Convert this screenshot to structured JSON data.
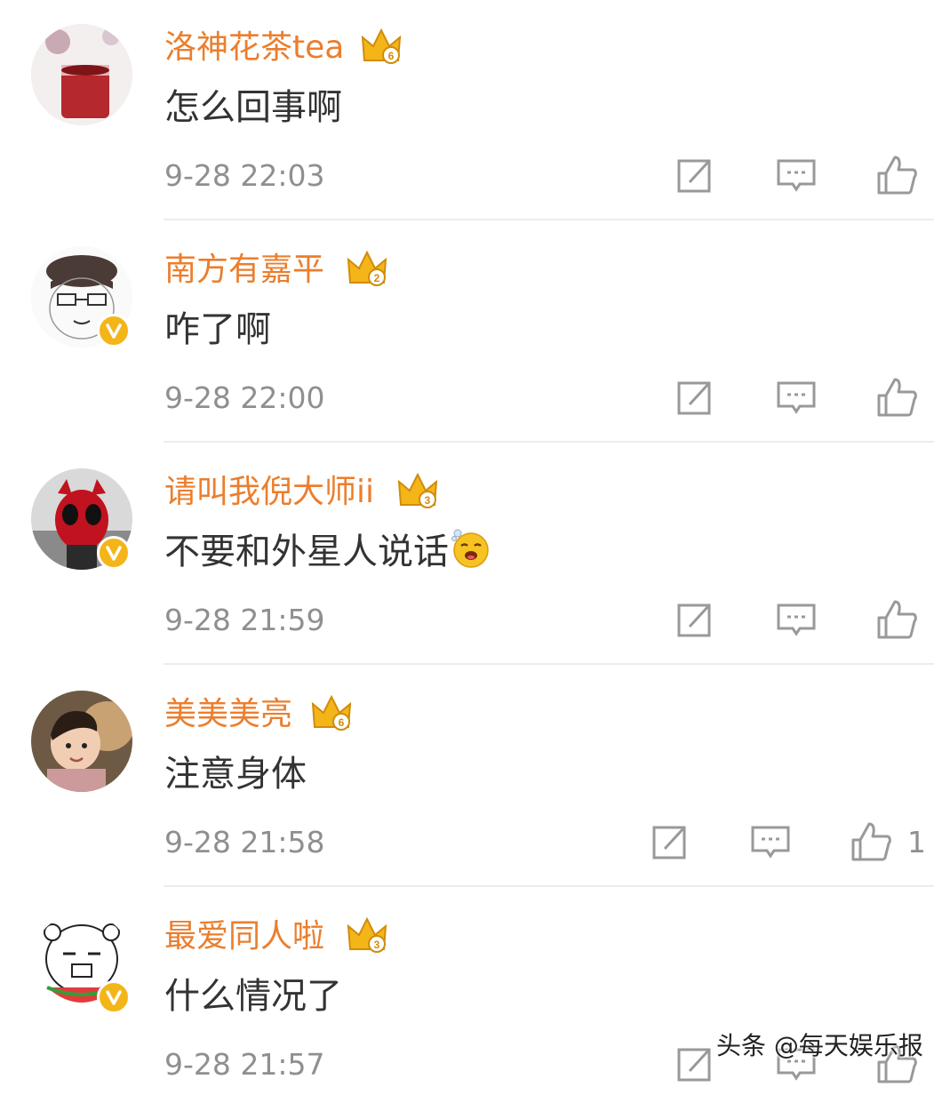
{
  "comments": [
    {
      "username": "洛神花茶tea",
      "level": "6",
      "text": "怎么回事啊",
      "time": "9-28 22:03",
      "likes": "",
      "verified": false,
      "avatar": "avatar-rose-tea"
    },
    {
      "username": "南方有嘉平",
      "level": "2",
      "text": "咋了啊",
      "time": "9-28 22:00",
      "likes": "",
      "verified": true,
      "avatar": "avatar-cartoon-glasses"
    },
    {
      "username": "请叫我倪大师ii",
      "level": "3",
      "text": "不要和外星人说话",
      "time": "9-28 21:59",
      "likes": "",
      "verified": true,
      "emoji": "yawn-emoji",
      "avatar": "avatar-red-hero"
    },
    {
      "username": "美美美亮",
      "level": "6",
      "text": "注意身体",
      "time": "9-28 21:58",
      "likes": "1",
      "verified": false,
      "avatar": "avatar-girl-dog"
    },
    {
      "username": "最爱同人啦",
      "level": "3",
      "text": "什么情况了",
      "time": "9-28 21:57",
      "likes": "",
      "verified": true,
      "avatar": "avatar-meme-watermelon"
    }
  ],
  "icons": {
    "repost": "repost-icon",
    "reply": "comment-icon",
    "like": "thumbs-up-icon",
    "member": "crown-icon",
    "verified": "verified-v-icon"
  },
  "colors": {
    "username": "#eb7e2d",
    "crown": "#f4b519",
    "text": "#333333",
    "meta": "#8f8f8f"
  },
  "watermark": "头条 @每天娱乐报"
}
